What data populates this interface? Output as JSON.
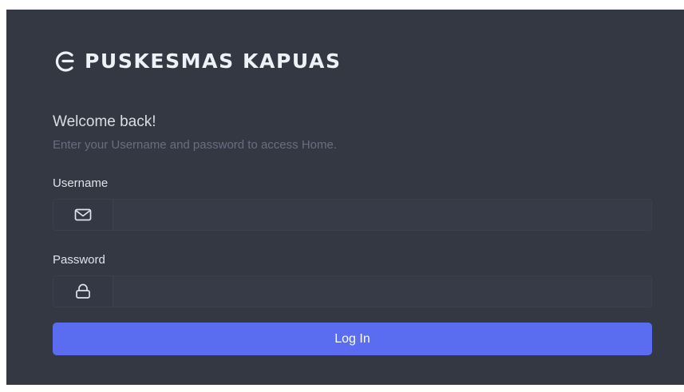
{
  "brand": {
    "name": "PUSKESMAS KAPUAS",
    "logo_icon": "brand-logo-icon"
  },
  "heading": {
    "title": "Welcome back!",
    "subtitle": "Enter your Username and password to access Home."
  },
  "form": {
    "username": {
      "label": "Username",
      "value": "",
      "placeholder": "",
      "icon": "mail-icon"
    },
    "password": {
      "label": "Password",
      "value": "",
      "placeholder": "",
      "icon": "lock-icon"
    },
    "submit_label": "Log In"
  },
  "colors": {
    "panel_background": "#343843",
    "accent": "#5a6df0",
    "text_primary": "#eef1f5",
    "text_muted": "#666f80"
  }
}
